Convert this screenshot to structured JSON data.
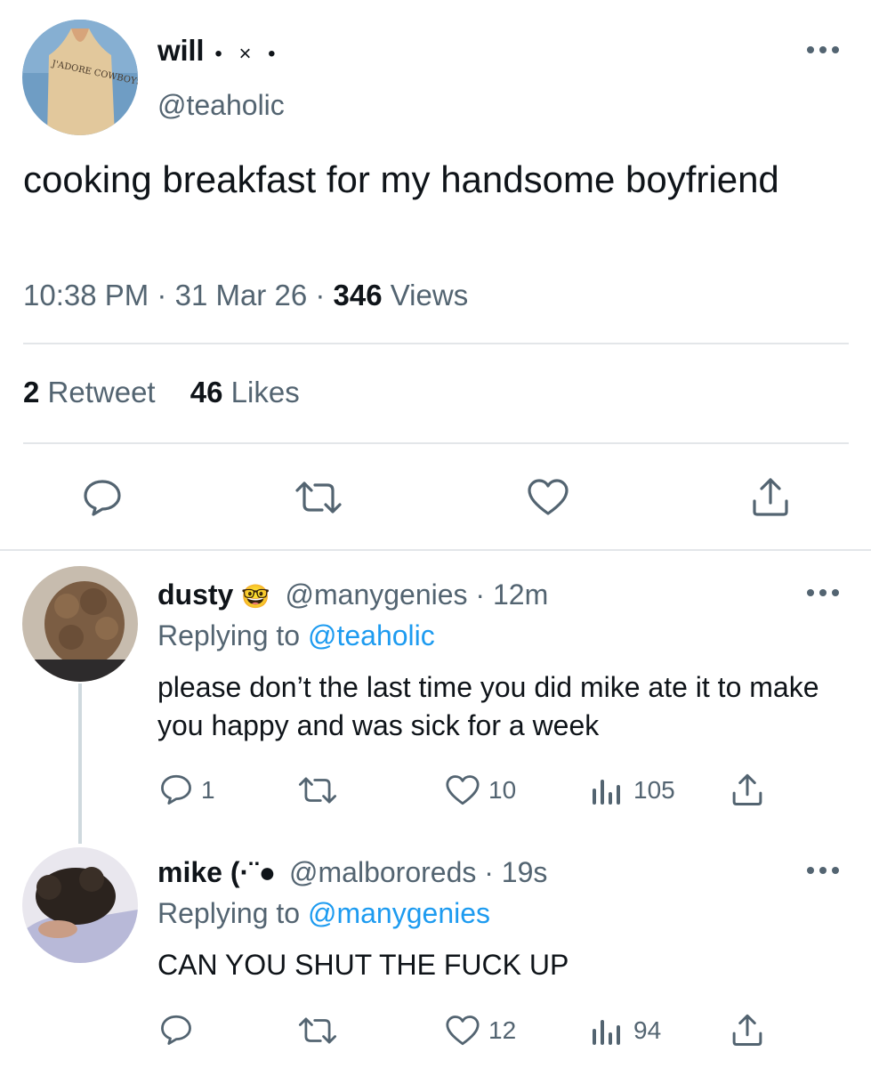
{
  "tweet": {
    "display_name": "will",
    "name_decoration": "• × •",
    "handle": "@teaholic",
    "text": "cooking breakfast for my handsome boyfriend",
    "time": "10:38 PM",
    "date": "31 Mar 26",
    "views_count": "346",
    "views_label": "Views",
    "retweets_count": "2",
    "retweets_label": "Retweet",
    "likes_count": "46",
    "likes_label": "Likes",
    "avatar_shirt_text": "J'ADORE COWBOYS"
  },
  "replies": [
    {
      "display_name": "dusty",
      "emoji": "🤓",
      "handle": "@manygenies",
      "time": "12m",
      "replying_label": "Replying to",
      "replying_to": "@teaholic",
      "text": "please don’t the last time you did mike ate it to make you happy and was sick for a week",
      "reply_count": "1",
      "retweet_count": "",
      "like_count": "10",
      "view_count": "105"
    },
    {
      "display_name": "mike",
      "name_decoration": "(·¨●",
      "handle": "@malbororeds",
      "time": "19s",
      "replying_label": "Replying to",
      "replying_to": "@manygenies",
      "text": "CAN YOU SHUT THE FUCK UP",
      "reply_count": "",
      "retweet_count": "",
      "like_count": "12",
      "view_count": "94"
    }
  ],
  "separator": "·",
  "icons": {
    "more": "more-horizontal-icon",
    "reply": "reply-icon",
    "retweet": "retweet-icon",
    "like": "heart-icon",
    "share": "share-icon",
    "views": "views-chart-icon"
  },
  "colors": {
    "text": "#0f1419",
    "secondary": "#536471",
    "link": "#1d9bf0",
    "divider": "#e3e6e9"
  }
}
